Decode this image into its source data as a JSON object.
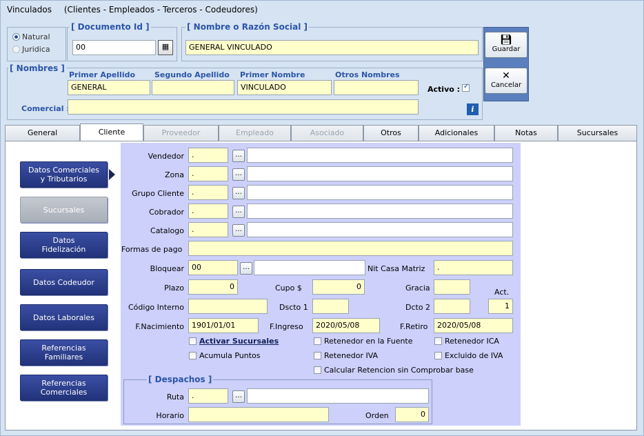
{
  "window": {
    "title": "Vinculados",
    "subtitle": "(Clientes - Empleados - Terceros - Codeudores)"
  },
  "person_type": {
    "natural": "Natural",
    "juridica": "Juridica"
  },
  "documento": {
    "legend": "[ Documento Id ]",
    "value": "00"
  },
  "razon_social": {
    "legend": "[ Nombre o Razón Social ]",
    "value": "GENERAL VINCULADO"
  },
  "toolbar": {
    "guardar": "Guardar",
    "cancelar": "Cancelar"
  },
  "nombres": {
    "legend": "[ Nombres ]",
    "headers": [
      "Primer Apellido",
      "Segundo Apellido",
      "Primer Nombre",
      "Otros Nombres"
    ],
    "values": [
      "GENERAL",
      "",
      "VINCULADO",
      ""
    ],
    "activo_label": "Activo :",
    "comercial_label": "Comercial :",
    "comercial_value": "",
    "info_icon": "i"
  },
  "tabs": [
    {
      "label": "General",
      "state": "normal"
    },
    {
      "label": "Cliente",
      "state": "active"
    },
    {
      "label": "Proveedor",
      "state": "disabled"
    },
    {
      "label": "Empleado",
      "state": "disabled"
    },
    {
      "label": "Asociado",
      "state": "disabled"
    },
    {
      "label": "Otros",
      "state": "normal"
    },
    {
      "label": "Adicionales",
      "state": "normal"
    },
    {
      "label": "Notas",
      "state": "normal"
    },
    {
      "label": "Sucursales",
      "state": "normal"
    }
  ],
  "side_buttons": [
    {
      "line1": "Datos Comerciales",
      "line2": "y Tributarios"
    },
    {
      "line1": "Sucursales",
      "line2": ""
    },
    {
      "line1": "Datos",
      "line2": "Fidelización"
    },
    {
      "line1": "Datos Codeudor",
      "line2": ""
    },
    {
      "line1": "Datos Laborales",
      "line2": ""
    },
    {
      "line1": "Referencias",
      "line2": "Familiares"
    },
    {
      "line1": "Referencias",
      "line2": "Comerciales"
    }
  ],
  "form": {
    "vendedor": {
      "label": "Vendedor",
      "code": ".",
      "desc": ""
    },
    "zona": {
      "label": "Zona",
      "code": ".",
      "desc": ""
    },
    "grupo_cliente": {
      "label": "Grupo Cliente",
      "code": ".",
      "desc": ""
    },
    "cobrador": {
      "label": "Cobrador",
      "code": ".",
      "desc": ""
    },
    "catalogo": {
      "label": "Catalogo",
      "code": ".",
      "desc": ""
    },
    "formas_pago": {
      "label": "Formas de pago",
      "value": ""
    },
    "bloquear": {
      "label": "Bloquear",
      "value": "00",
      "desc": ""
    },
    "nit_casa_matriz": {
      "label": "Nit Casa Matriz",
      "value": "."
    },
    "plazo": {
      "label": "Plazo",
      "value": "0"
    },
    "cupo": {
      "label": "Cupo $",
      "value": "0"
    },
    "gracia": {
      "label": "Gracia",
      "value": ""
    },
    "act": {
      "label": "Act.",
      "value": "1"
    },
    "codigo_interno": {
      "label": "Código Interno",
      "value": ""
    },
    "dscto1": {
      "label": "Dscto 1",
      "value": ""
    },
    "dcto2": {
      "label": "Dcto 2",
      "value": ""
    },
    "f_nacimiento": {
      "label": "F.Nacimiento",
      "value": "1901/01/01"
    },
    "f_ingreso": {
      "label": "F.Ingreso",
      "value": "2020/05/08"
    },
    "f_retiro": {
      "label": "F.Retiro",
      "value": "2020/05/08"
    },
    "checks": {
      "activar_sucursales": "Activar Sucursales",
      "retenedor_fuente": "Retenedor en la Fuente",
      "retenedor_ica": "Retenedor ICA",
      "acumula_puntos": "Acumula Puntos",
      "retenedor_iva": "Retenedor IVA",
      "excluido_iva": "Excluido de IVA",
      "calcular_retencion": "Calcular Retencion sin Comprobar base"
    },
    "despachos": {
      "legend": "[ Despachos ]",
      "ruta_label": "Ruta",
      "ruta_code": ".",
      "ruta_desc": "",
      "horario_label": "Horario",
      "horario_value": "",
      "orden_label": "Orden",
      "orden_value": "0"
    }
  }
}
